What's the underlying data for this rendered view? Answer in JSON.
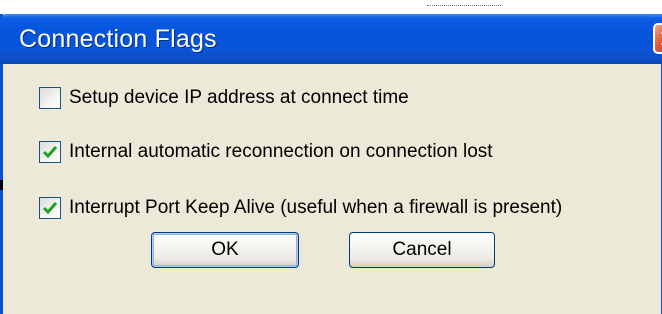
{
  "window": {
    "title": "Connection Flags",
    "close_icon": "close-icon"
  },
  "options": [
    {
      "label": "Setup device IP address at connect time",
      "checked": false
    },
    {
      "label": "Internal automatic reconnection on connection lost",
      "checked": true
    },
    {
      "label": "Interrupt Port Keep Alive (useful when a firewall is present)",
      "checked": true
    }
  ],
  "buttons": {
    "ok_label": "OK",
    "cancel_label": "Cancel"
  },
  "colors": {
    "titlebar": "#0454db",
    "window_border": "#0a50d6",
    "dialog_bg": "#ece9d8",
    "close_button": "#e2562f",
    "checkmark": "#21a121"
  }
}
